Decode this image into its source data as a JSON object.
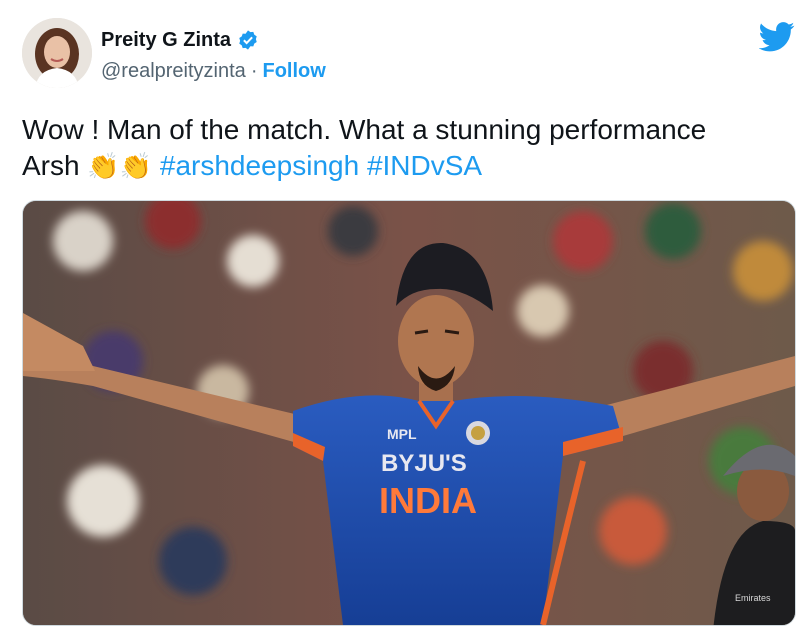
{
  "author": {
    "display_name": "Preity G Zinta",
    "handle": "@realpreityzinta",
    "separator": "·",
    "follow_label": "Follow",
    "verified": true,
    "avatar_icon": "profile-photo"
  },
  "platform_icon": "twitter-bird-icon",
  "tweet": {
    "text_part1": "Wow ! Man of the match. What a stunning performance",
    "text_part2": "Arsh",
    "emoji": "👏👏",
    "hashtags": [
      "#arshdeepsingh",
      "#INDvSA"
    ]
  },
  "media": {
    "jersey_sponsor": "BYJU'S",
    "jersey_text": "INDIA",
    "jersey_brand": "MPL",
    "umpire_badge": "Emirates"
  },
  "colors": {
    "link": "#1d9bf0",
    "text": "#0f1419",
    "muted": "#536471",
    "verified": "#1d9bf0",
    "jersey": "#1f4fb3"
  }
}
